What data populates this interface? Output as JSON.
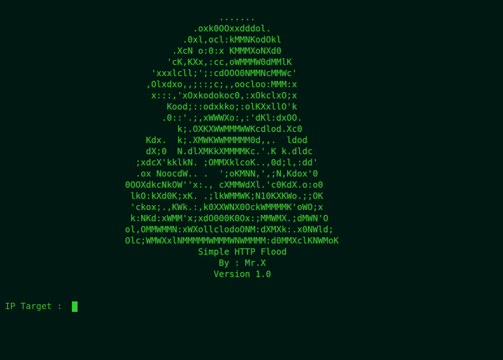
{
  "banner": {
    "lines": [
      "                                          .......",
      "                                     .oxk0OOxxdddol.",
      "                                   .0xl,ocl:kMMNKodOkl",
      "                                 .XcN o:0:x KMMMXoNXd0",
      "                                'cK,KXx,:cc,oWMMMW0dMMlK",
      "                             'xxxlcll;';:cdOOO0NMMNcMMWc'",
      "                            ,Olxdxo,,;::;c;,,oocloo:MMM:x",
      "                             x:::,'xOxkodokoc0,:xOkclxO;x",
      "                                Kood;::odxkko;:olKXxllO'k",
      "                               .0::'.;,xWWWXo:,:'dKl:dxOO.",
      "                                  k;.OXKXWWMMMWWKcdlod.Xc0",
      "                            Kdx.  k;.XMWKWWMMMMM0d,,.  ldod",
      "                            dX;0  N.dlXMKkXMMMMKc.'.K k.dldc",
      "                          ;xdcX'kklkN. ;OMMXklcoK..,0d;l,:dd'",
      "                          .ox NoocdW.. .  ';oKMNN,',;N,Kdox'0",
      "                        0OOXdkcNkOW''x:., cXMMWdXl.'c0KdX.o:o0",
      "                         lkO:kXd0K;xK. .;lkWMMWK;N10KXKWo.;;OK",
      "                         'ckox;.,KWk.:,k0XXWNX0OckWMMMMK'oWO;x",
      "                         k:NKd:xWMM'x;xdO000K0Ox:;MMWMX.;dMWN'O",
      "                        ol,OMMWMMN:xWXollclodoONM:dXMXk:.x0NWld;",
      "                        Olc;WMWXxlNMMMMMWMMMWNWMMMM:d0MMXclKNWMoK",
      "                                      Simple HTTP Flood",
      "                                          By : Mr.X",
      "                                         Version 1.0"
    ]
  },
  "prompt": {
    "label": "IP Target : "
  }
}
